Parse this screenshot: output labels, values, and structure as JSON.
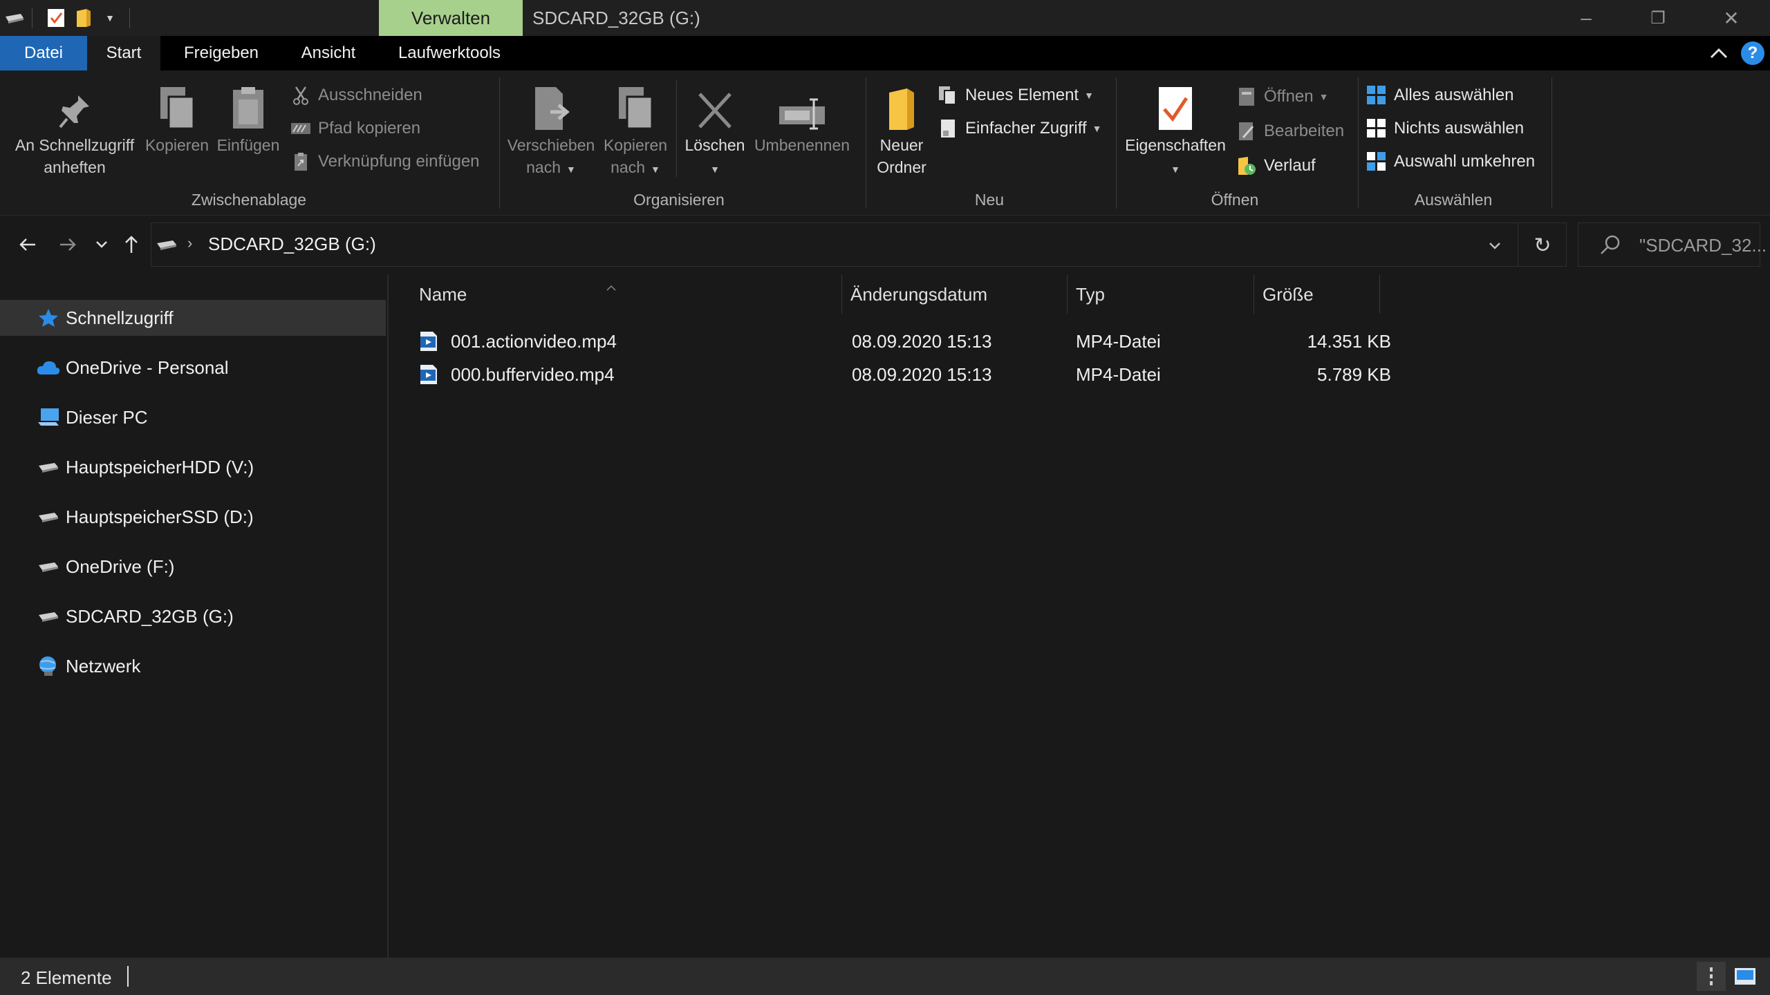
{
  "titlebar": {
    "manage_tab": "Verwalten",
    "title": "SDCARD_32GB (G:)",
    "minimize_symbol": "–",
    "maximize_symbol": "❐",
    "close_symbol": "✕"
  },
  "tabs": [
    "Datei",
    "Start",
    "Freigeben",
    "Ansicht",
    "Laufwerktools"
  ],
  "ribbon": {
    "clipboard": {
      "pin_line1": "An Schnellzugriff",
      "pin_line2": "anheften",
      "copy": "Kopieren",
      "paste": "Einfügen",
      "cut": "Ausschneiden",
      "copy_path": "Pfad kopieren",
      "paste_shortcut": "Verknüpfung einfügen",
      "label": "Zwischenablage"
    },
    "organize": {
      "move_line1": "Verschieben",
      "move_line2": "nach",
      "copyto_line1": "Kopieren",
      "copyto_line2": "nach",
      "delete": "Löschen",
      "rename": "Umbenennen",
      "label": "Organisieren"
    },
    "new": {
      "folder_line1": "Neuer",
      "folder_line2": "Ordner",
      "new_item": "Neues Element",
      "easy_access": "Einfacher Zugriff",
      "label": "Neu"
    },
    "open": {
      "properties": "Eigenschaften",
      "open": "Öffnen",
      "edit": "Bearbeiten",
      "history": "Verlauf",
      "label": "Öffnen"
    },
    "select": {
      "select_all": "Alles auswählen",
      "select_none": "Nichts auswählen",
      "invert": "Auswahl umkehren",
      "label": "Auswählen"
    }
  },
  "address": {
    "path": "SDCARD_32GB (G:)",
    "search_placeholder": "\"SDCARD_32..."
  },
  "nav": {
    "items": [
      {
        "label": "Schnellzugriff",
        "icon": "star-icon"
      },
      {
        "label": "OneDrive - Personal",
        "icon": "cloud-icon"
      },
      {
        "label": "Dieser PC",
        "icon": "computer-icon"
      },
      {
        "label": "HauptspeicherHDD (V:)",
        "icon": "drive-icon"
      },
      {
        "label": "HauptspeicherSSD (D:)",
        "icon": "drive-icon"
      },
      {
        "label": "OneDrive (F:)",
        "icon": "drive-icon"
      },
      {
        "label": "SDCARD_32GB (G:)",
        "icon": "drive-icon"
      },
      {
        "label": "Netzwerk",
        "icon": "network-icon"
      }
    ]
  },
  "files": {
    "columns": [
      "Name",
      "Änderungsdatum",
      "Typ",
      "Größe"
    ],
    "rows": [
      {
        "name": "001.actionvideo.mp4",
        "date": "08.09.2020 15:13",
        "type": "MP4-Datei",
        "size": "14.351 KB"
      },
      {
        "name": "000.buffervideo.mp4",
        "date": "08.09.2020 15:13",
        "type": "MP4-Datei",
        "size": "5.789 KB"
      }
    ]
  },
  "status": {
    "count": "2 Elemente"
  },
  "colors": {
    "file_tab": "#1f67b5",
    "manage_tab": "#a8d08d",
    "background": "#191919",
    "accent_blue": "#2b8ce8"
  }
}
